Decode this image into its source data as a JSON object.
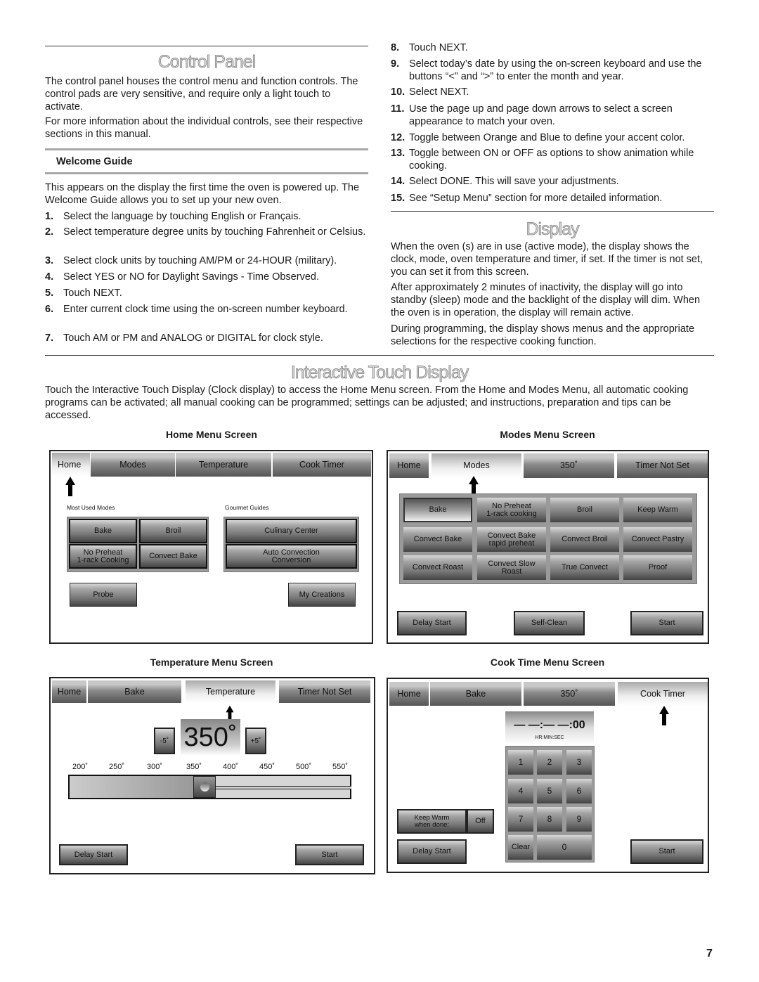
{
  "control_panel": {
    "title": "Control Panel",
    "paragraphs": [
      "The control panel houses the control menu and function controls. The control pads are very sensitive, and require only a light touch to activate.",
      "For more information about the individual controls, see their respective sections in this manual."
    ]
  },
  "welcome_guide": {
    "heading": "Welcome Guide",
    "intro": "This appears on the display the first time the oven is powered up. The Welcome Guide allows you to set up your new oven.",
    "steps": [
      {
        "n": "1.",
        "text": "Select the language by touching English or Français."
      },
      {
        "n": "2.",
        "text": "Select temperature degree units by touching Fahrenheit or Celsius."
      },
      {
        "n": "3.",
        "text": "Select clock units by touching AM/PM or 24-HOUR (military)."
      },
      {
        "n": "4.",
        "text": "Select YES or NO for Daylight Savings - Time Observed."
      },
      {
        "n": "5.",
        "text": "Touch NEXT."
      },
      {
        "n": "6.",
        "text": "Enter current clock time using the on-screen number keyboard."
      },
      {
        "n": "7.",
        "text": "Touch AM or PM and ANALOG or DIGITAL for clock style."
      },
      {
        "n": "8.",
        "text": "Touch NEXT."
      },
      {
        "n": "9.",
        "text": "Select today’s date by using the on-screen keyboard and use the buttons “<” and “>” to enter the month and year."
      },
      {
        "n": "10.",
        "text": "Select NEXT."
      },
      {
        "n": "11.",
        "text": "Use the page up and page down arrows to select a screen appearance to match your oven."
      },
      {
        "n": "12.",
        "text": "Toggle between Orange and Blue to define your accent color."
      },
      {
        "n": "13.",
        "text": "Toggle between ON or OFF as options to show animation while cooking."
      },
      {
        "n": "14.",
        "text": "Select DONE. This will save your adjustments."
      },
      {
        "n": "15.",
        "text": "See “Setup Menu” section for more detailed information."
      }
    ]
  },
  "display": {
    "title": "Display",
    "paragraphs": [
      "When the oven (s) are in use (active mode), the display shows the clock, mode, oven temperature and timer, if set. If the timer is not set, you can set it from this screen.",
      "After approximately 2 minutes of inactivity, the display will go into standby (sleep) mode and the backlight of the display will dim. When the oven is in operation, the display will remain active.",
      "During programming, the display shows menus and the appropriate selections for the respective cooking function."
    ]
  },
  "interactive": {
    "title": "Interactive Touch Display",
    "paragraph": "Touch the Interactive Touch Display (Clock display) to access the Home Menu screen. From the Home and Modes Menu, all automatic cooking programs can be activated; all manual cooking can be programmed; settings can be adjusted; and instructions, preparation and tips can be accessed."
  },
  "screens": {
    "home": {
      "caption": "Home Menu Screen",
      "tabs": [
        "Home",
        "Modes",
        "Temperature",
        "Cook Timer"
      ],
      "selected_tab": "Home",
      "most_used_label": "Most Used Modes",
      "most_used": [
        "Bake",
        "Broil",
        "No Preheat\n1-rack Cooking",
        "Convect Bake"
      ],
      "gourmet_label": "Gourmet Guides",
      "gourmet": [
        "Culinary Center",
        "Auto Convection\nConversion"
      ],
      "probe": "Probe",
      "my_creations": "My Creations"
    },
    "modes": {
      "caption": "Modes Menu Screen",
      "tabs": [
        "Home",
        "Modes",
        "350˚",
        "Timer Not Set"
      ],
      "selected_tab": "Modes",
      "modes": [
        "Bake",
        "No Preheat\n1-rack cooking",
        "Broil",
        "Keep Warm",
        "Convect Bake",
        "Convect Bake\nrapid preheat",
        "Convect Broil",
        "Convect Pastry",
        "Convect Roast",
        "Convect Slow\nRoast",
        "True Convect",
        "Proof"
      ],
      "selected_mode": "Bake",
      "delay_start": "Delay Start",
      "self_clean": "Self-Clean",
      "start": "Start"
    },
    "temperature": {
      "caption": "Temperature Menu Screen",
      "tabs": [
        "Home",
        "Bake",
        "Temperature",
        "Timer Not Set"
      ],
      "selected_tab": "Temperature",
      "minus": "-5˚",
      "value": "350˚",
      "plus": "+5˚",
      "scale": [
        "200˚",
        "250˚",
        "300˚",
        "350˚",
        "400˚",
        "450˚",
        "500˚",
        "550˚"
      ],
      "slider_value": 350,
      "delay_start": "Delay Start",
      "start": "Start"
    },
    "cook_time": {
      "caption": "Cook Time Menu Screen",
      "tabs": [
        "Home",
        "Bake",
        "350˚",
        "Cook Timer"
      ],
      "selected_tab": "Cook Timer",
      "timer": "— —:— —:00",
      "timer_units": "HR:MIN:SEC",
      "keys": [
        "1",
        "2",
        "3",
        "4",
        "5",
        "6",
        "7",
        "8",
        "9",
        "Clear",
        "0"
      ],
      "keep_warm": "Keep Warm\nwhen done:",
      "keep_warm_value": "Off",
      "delay_start": "Delay Start",
      "start": "Start"
    }
  },
  "page_number": "7"
}
